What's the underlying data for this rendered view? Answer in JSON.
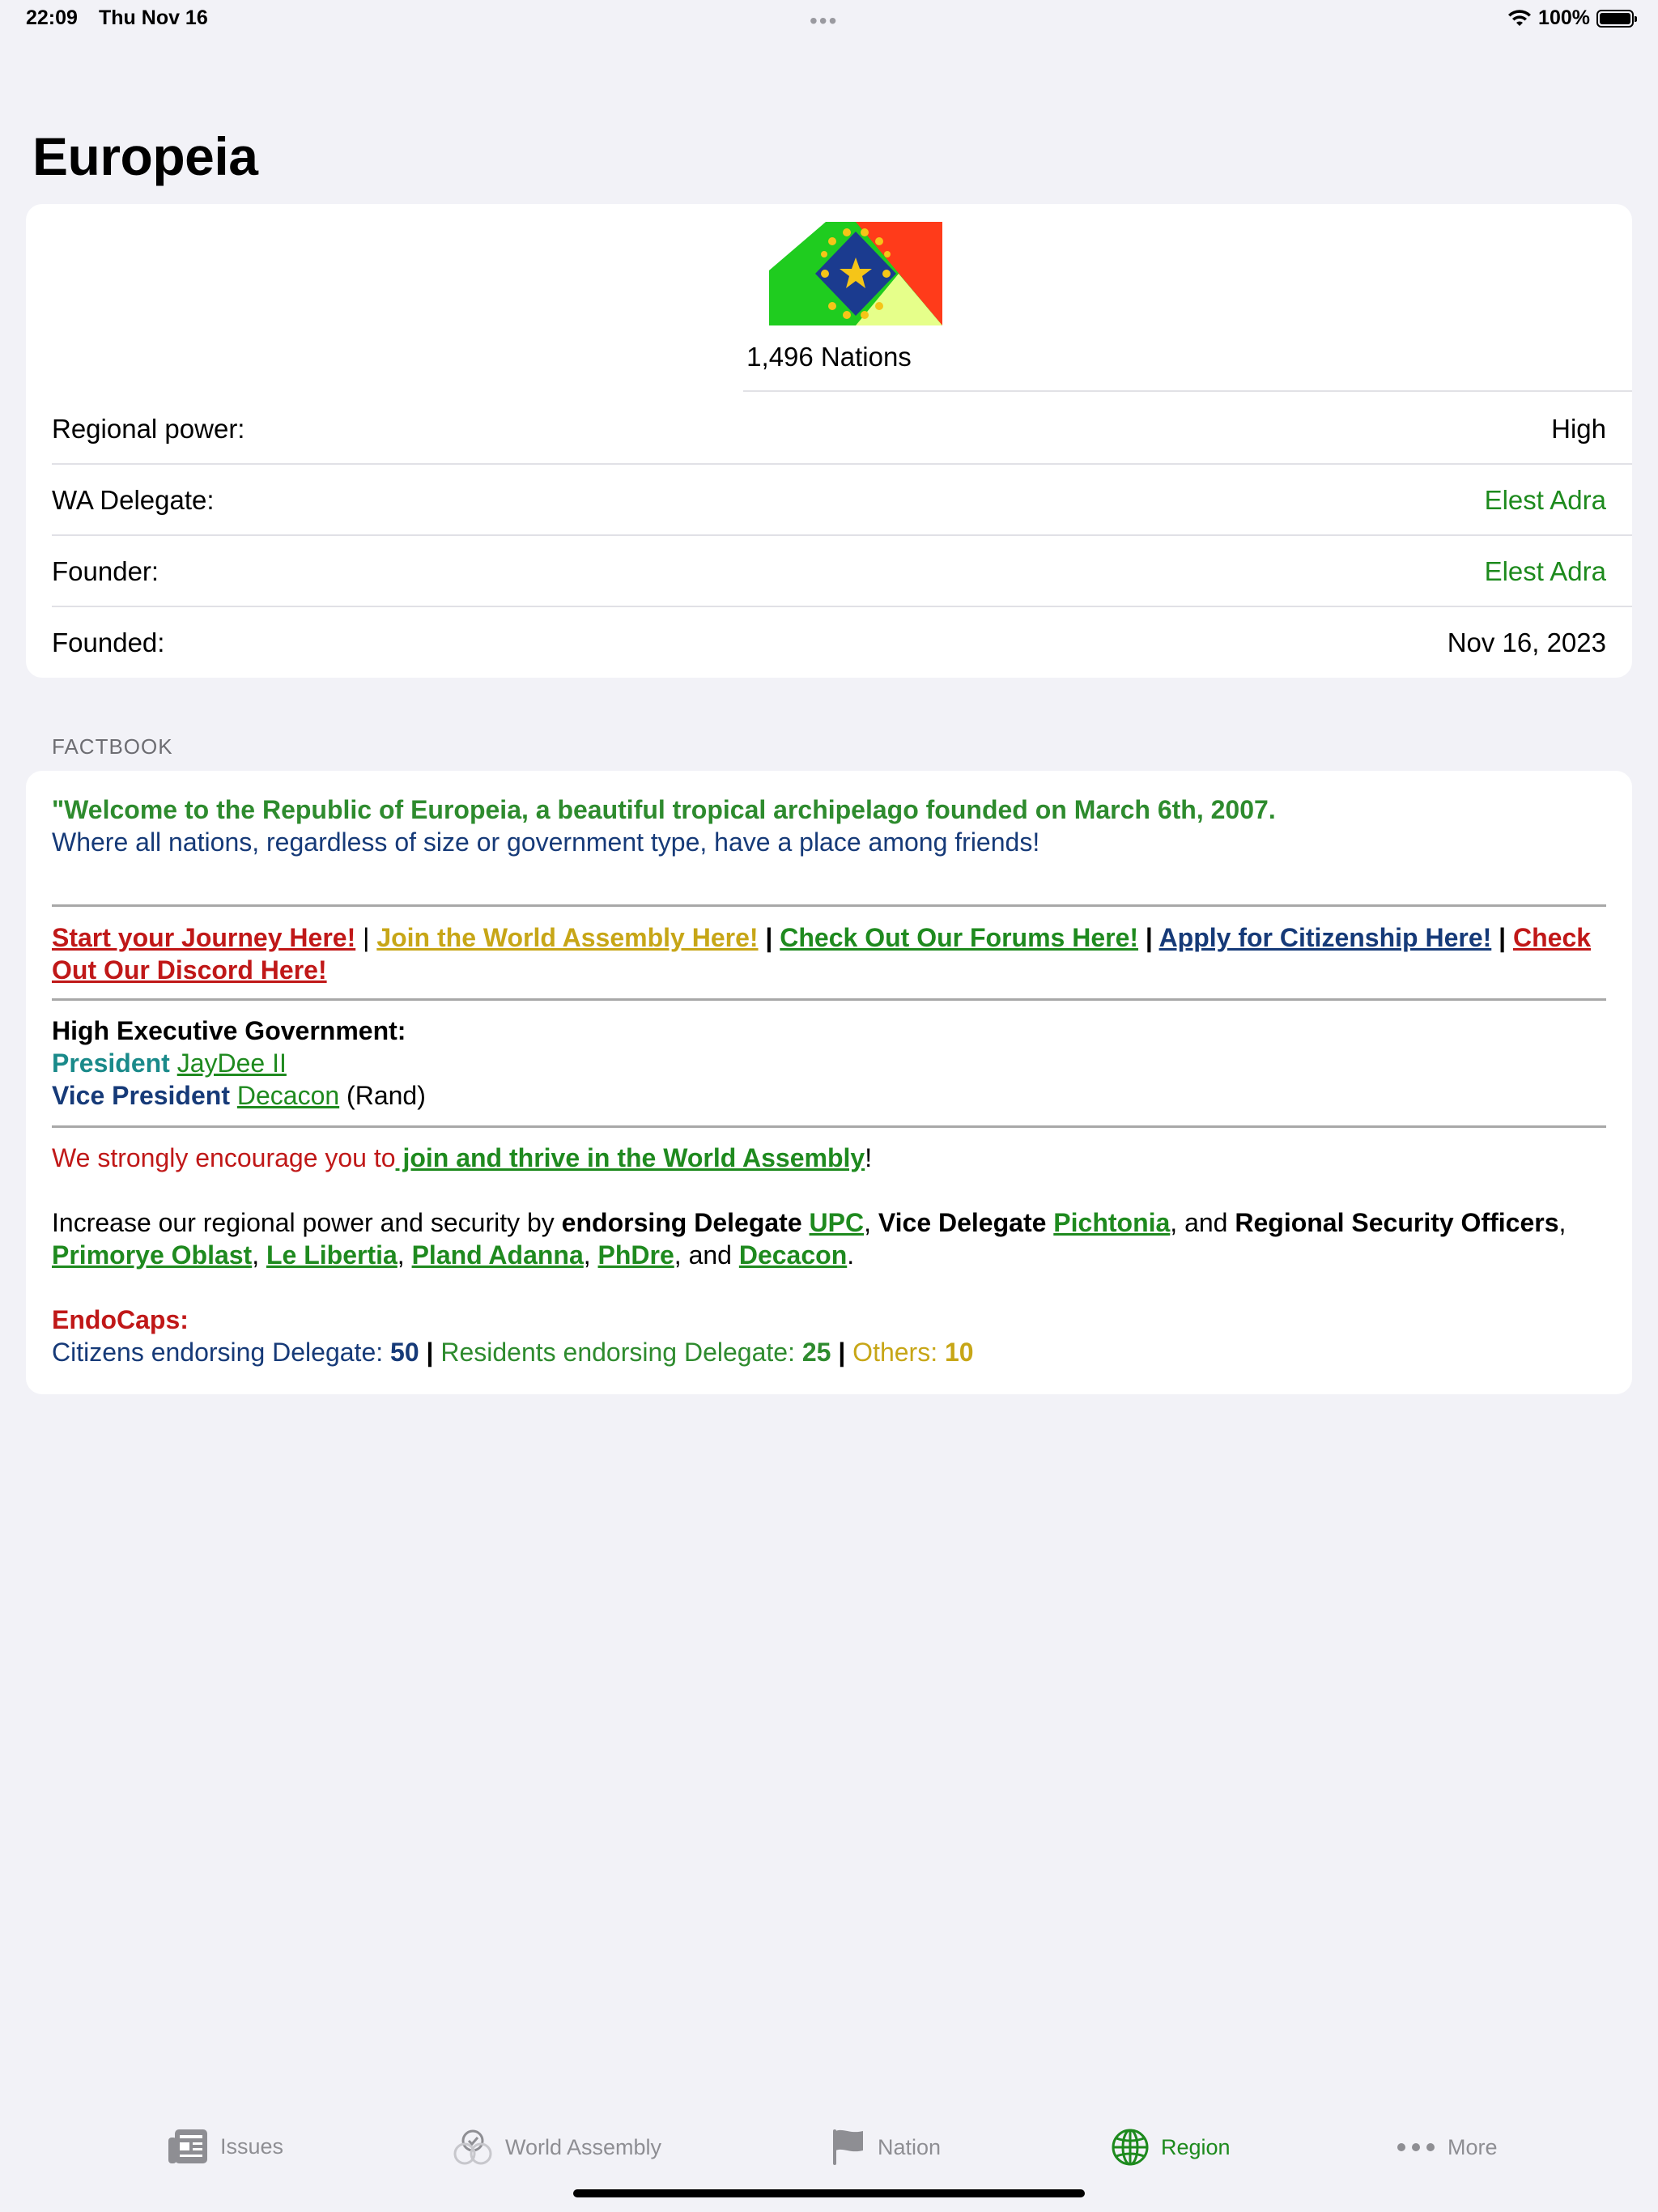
{
  "status_bar": {
    "time": "22:09",
    "date": "Thu Nov 16",
    "battery": "100%"
  },
  "page_title": "Europeia",
  "region_card": {
    "nations": "1,496 Nations",
    "rows": [
      {
        "label": "Regional power:",
        "value": "High"
      },
      {
        "label": "WA Delegate:",
        "value": "Elest Adra"
      },
      {
        "label": "Founder:",
        "value": "Elest Adra"
      },
      {
        "label": "Founded:",
        "value": "Nov 16, 2023"
      }
    ]
  },
  "factbook": {
    "section_label": "FACTBOOK",
    "welcome": "\"Welcome to the Republic of Europeia, a beautiful tropical archipelago founded on March 6th, 2007.",
    "subwelcome": "Where all nations, regardless of size or government type, have a place among friends!",
    "links": {
      "journey": "Start your Journey Here!",
      "wa": "Join the World Assembly Here!",
      "forums": "Check Out Our Forums Here!",
      "citizenship": "Apply for Citizenship Here!",
      "discord_1": "Check",
      "discord_2": "Out Our Discord Here!",
      "separator": " | "
    },
    "gov": {
      "heading": "High Executive Government:",
      "president_label": "President",
      "president_name": "JayDee II",
      "vp_label": "Vice President",
      "vp_name": "Decacon",
      "vp_note": "(Rand)"
    },
    "encourage": {
      "text": "We strongly encourage you to",
      "link": " join and thrive in the World Assembly",
      "end": "!"
    },
    "increase": {
      "p1": "Increase our regional power and security by ",
      "b1": "endorsing Delegate ",
      "delegate": "UPC",
      "p2": ", ",
      "b2": "Vice Delegate ",
      "vice": "Pichtonia",
      "p3": ", and ",
      "b3": "Regional Security Officers",
      "p4": ",",
      "rso": [
        "Primorye Oblast",
        "Le Libertia",
        "Pland Adanna",
        "PhDre",
        "Decacon"
      ],
      "sep": ", ",
      "and": ", and ",
      "end": "."
    },
    "endocaps": {
      "heading": "EndoCaps:",
      "citizens_label": "Citizens endorsing Delegate: ",
      "citizens_value": "50",
      "residents_label": "Residents endorsing Delegate: ",
      "residents_value": "25",
      "others_label": "Others: ",
      "others_value": "10",
      "bar": " | "
    }
  },
  "tabs": [
    {
      "label": "Issues",
      "icon": "newspaper-icon"
    },
    {
      "label": "World Assembly",
      "icon": "wa-icon"
    },
    {
      "label": "Nation",
      "icon": "flag-icon"
    },
    {
      "label": "Region",
      "icon": "globe-icon"
    },
    {
      "label": "More",
      "icon": "ellipsis-icon"
    }
  ],
  "colors": {
    "accent": "#1d8a1d",
    "background": "#f2f2f7"
  }
}
